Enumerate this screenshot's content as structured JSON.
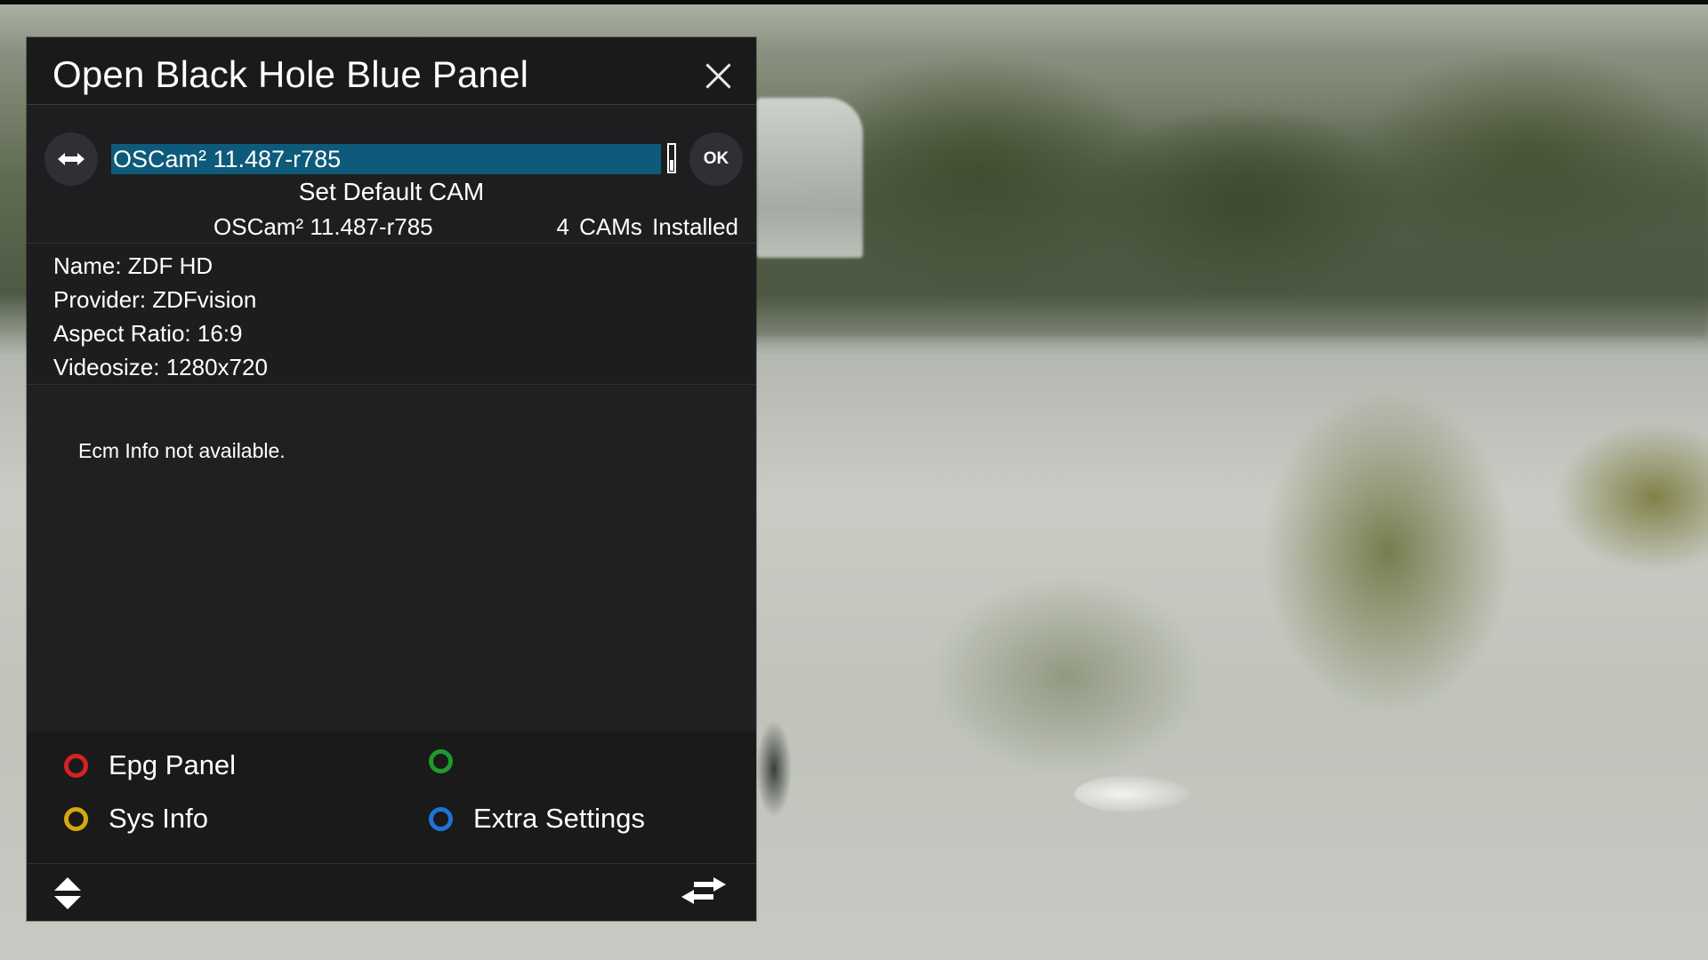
{
  "panel": {
    "title": "Open Black Hole Blue Panel",
    "close_icon": "close-icon"
  },
  "cam": {
    "selected": "OSCam² 11.487-r785",
    "ok_label": "OK",
    "set_default_label": "Set Default CAM",
    "current": "OSCam² 11.487-r785",
    "installed_count": "4",
    "installed_label": "CAMs Installed",
    "selector_color": "#0e5a7a"
  },
  "channel_info": {
    "name": "Name: ZDF HD",
    "provider": "Provider: ZDFvision",
    "aspect_ratio": "Aspect Ratio: 16:9",
    "videosize": "Videosize: 1280x720"
  },
  "ecm": {
    "message": "Ecm Info not available."
  },
  "color_buttons": {
    "red": {
      "label": "Epg Panel",
      "color": "#d42323"
    },
    "green": {
      "label": "",
      "color": "#1e9a2c"
    },
    "yellow": {
      "label": "Sys Info",
      "color": "#d6a80d"
    },
    "blue": {
      "label": "Extra Settings",
      "color": "#1e73d6"
    }
  },
  "nav": {
    "left_icon": "up-down-arrows-icon",
    "right_icon": "swap-arrows-icon"
  }
}
